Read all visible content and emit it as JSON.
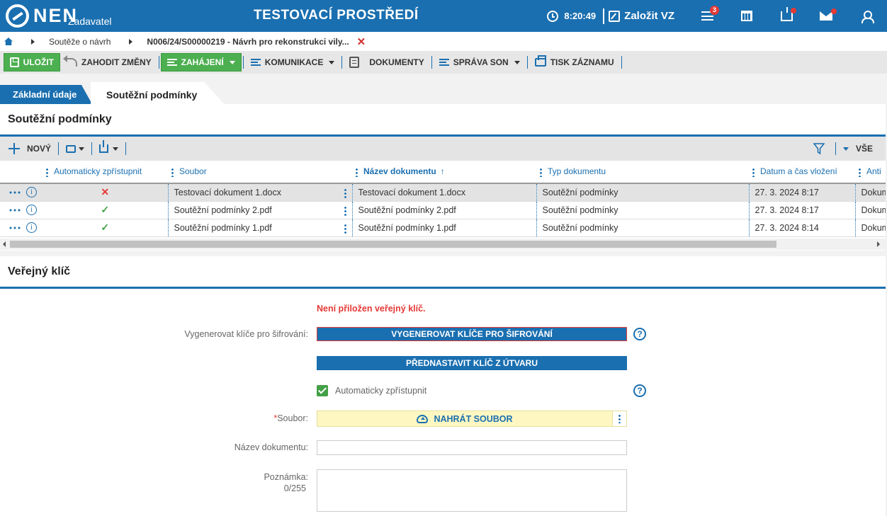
{
  "header": {
    "logo_text": "NEN",
    "logo_sub": "Zadavatel",
    "title": "TESTOVACÍ PROSTŘEDÍ",
    "time": "8:20:49",
    "create_label": "Založit VZ",
    "menu_badge": "3",
    "icons": [
      "clock-icon",
      "edit-icon",
      "menu-icon",
      "calendar-icon",
      "inbox-icon",
      "mail-icon",
      "user-icon"
    ]
  },
  "breadcrumb": {
    "items": [
      "Soutěže o návrh",
      "N006/24/S00000219 - Návrh pro rekonstrukci vily..."
    ]
  },
  "toolbar": {
    "save": "ULOŽIT",
    "discard": "ZAHODIT ZMĚNY",
    "start": "ZAHÁJENÍ",
    "communication": "KOMUNIKACE",
    "documents": "DOKUMENTY",
    "son": "SPRÁVA SON",
    "print": "TISK ZÁZNAMU"
  },
  "tabs": [
    {
      "label": "Základní údaje",
      "active": false
    },
    {
      "label": "Soutěžní podmínky",
      "active": true
    }
  ],
  "conditions": {
    "title": "Soutěžní podmínky",
    "new_label": "NOVÝ",
    "filter_all": "VŠE",
    "columns": [
      "Automaticky zpřístupnit",
      "Soubor",
      "Název dokumentu",
      "Typ dokumentu",
      "Datum a čas vložení",
      "Anti"
    ],
    "rows": [
      {
        "auto": "✕",
        "auto_ok": false,
        "file": "Testovací dokument 1.docx",
        "name": "Testovací dokument 1.docx",
        "type": "Soutěžní podmínky",
        "date": "27. 3. 2024 8:17",
        "extra": "Dokum"
      },
      {
        "auto": "✓",
        "auto_ok": true,
        "file": "Soutěžní podmínky 2.pdf",
        "name": "Soutěžní podmínky 2.pdf",
        "type": "Soutěžní podmínky",
        "date": "27. 3. 2024 8:17",
        "extra": "Dokum"
      },
      {
        "auto": "✓",
        "auto_ok": true,
        "file": "Soutěžní podmínky 1.pdf",
        "name": "Soutěžní podmínky 1.pdf",
        "type": "Soutěžní podmínky",
        "date": "27. 3. 2024 8:14",
        "extra": "Dokum"
      }
    ]
  },
  "public_key": {
    "title": "Veřejný klíč",
    "error": "Není přiložen veřejný klíč.",
    "generate_label": "Vygenerovat klíče pro šifrování:",
    "generate_button": "VYGENEROVAT KLÍČE PRO ŠIFROVÁNÍ",
    "preset_button": "PŘEDNASTAVIT KLÍČ Z ÚTVARU",
    "auto_label": "Automaticky zpřístupnit",
    "file_label": "Soubor:",
    "upload_button": "NAHRÁT SOUBOR",
    "doc_name_label": "Název dokumentu:",
    "doc_name_value": "",
    "note_label": "Poznámka:",
    "note_counter": "0/255",
    "note_value": ""
  }
}
